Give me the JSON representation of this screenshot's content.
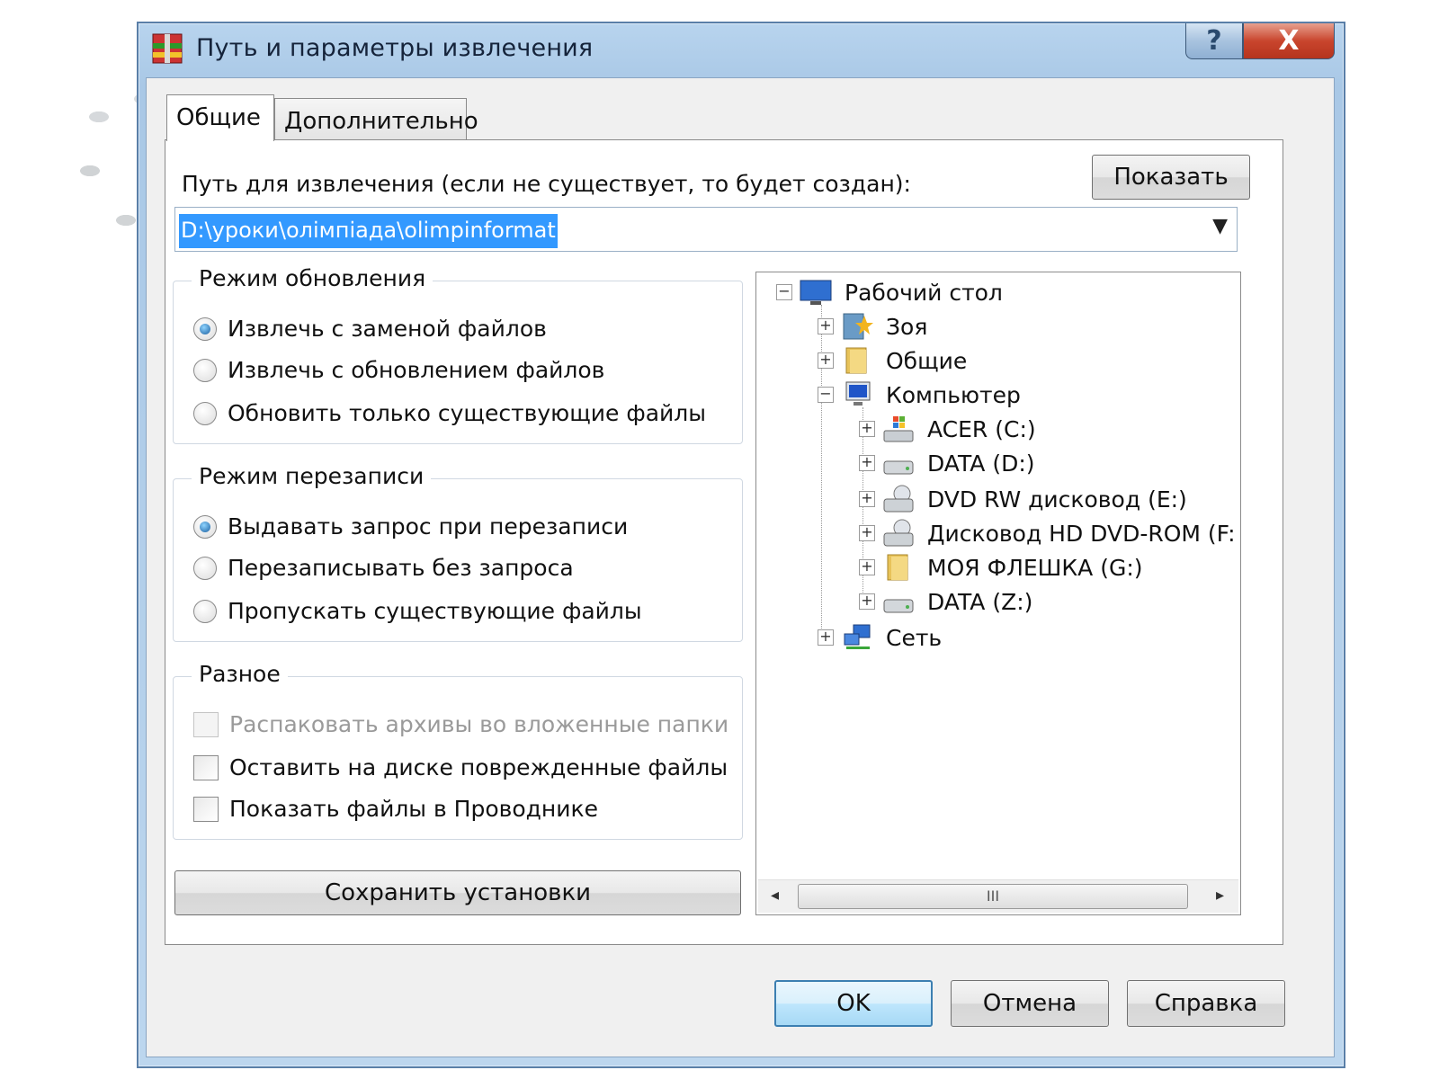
{
  "window": {
    "title": "Путь и параметры извлечения",
    "help_label": "?",
    "close_label": "X"
  },
  "tabs": [
    {
      "label": "Общие",
      "active": true
    },
    {
      "label": "Дополнительно",
      "active": false
    }
  ],
  "path": {
    "label": "Путь для извлечения (если не существует, то будет создан):",
    "value": "D:\\уроки\\олімпіада\\olimpinformat",
    "show_button": "Показать"
  },
  "update_mode": {
    "title": "Режим обновления",
    "options": [
      {
        "label": "Извлечь с заменой файлов",
        "checked": true
      },
      {
        "label": "Извлечь с обновлением файлов",
        "checked": false
      },
      {
        "label": "Обновить только существующие файлы",
        "checked": false
      }
    ]
  },
  "overwrite_mode": {
    "title": "Режим перезаписи",
    "options": [
      {
        "label": "Выдавать запрос при перезаписи",
        "checked": true
      },
      {
        "label": "Перезаписывать без запроса",
        "checked": false
      },
      {
        "label": "Пропускать существующие файлы",
        "checked": false
      }
    ]
  },
  "misc": {
    "title": "Разное",
    "options": [
      {
        "label": "Распаковать архивы во вложенные папки",
        "checked": false,
        "disabled": true
      },
      {
        "label": "Оставить на диске поврежденные файлы",
        "checked": false,
        "disabled": false
      },
      {
        "label": "Показать файлы в Проводнике",
        "checked": false,
        "disabled": false
      }
    ]
  },
  "save_settings": "Сохранить установки",
  "tree": {
    "nodes": [
      {
        "label": "Рабочий стол",
        "icon": "desktop-icon",
        "expander": "−"
      },
      {
        "label": "Зоя",
        "icon": "user-folder-icon",
        "expander": "+"
      },
      {
        "label": "Общие",
        "icon": "folder-icon",
        "expander": "+"
      },
      {
        "label": "Компьютер",
        "icon": "computer-icon",
        "expander": "−"
      },
      {
        "label": "ACER (C:)",
        "icon": "system-drive-icon",
        "expander": "+"
      },
      {
        "label": "DATA (D:)",
        "icon": "hard-drive-icon",
        "expander": "+"
      },
      {
        "label": "DVD RW дисковод (E:)",
        "icon": "dvd-drive-icon",
        "expander": "+"
      },
      {
        "label": "Дисковод HD DVD-ROM (F:",
        "icon": "dvd-drive-icon",
        "expander": "+"
      },
      {
        "label": "МОЯ ФЛЕШКА (G:)",
        "icon": "folder-icon",
        "expander": "+"
      },
      {
        "label": "DATA (Z:)",
        "icon": "hard-drive-icon",
        "expander": "+"
      },
      {
        "label": "Сеть",
        "icon": "network-icon",
        "expander": "+"
      }
    ],
    "scroll_left": "◂",
    "scroll_thumb": "III",
    "scroll_right": "▸"
  },
  "footer": {
    "ok": "OK",
    "cancel": "Отмена",
    "help": "Справка"
  },
  "colors": {
    "selection": "#3399ff",
    "frame": "#a9c8e6",
    "close": "#c9452d"
  }
}
